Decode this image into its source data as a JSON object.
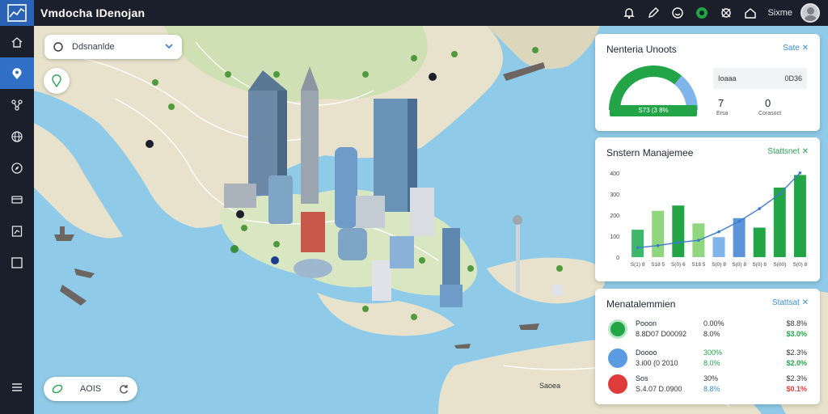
{
  "app": {
    "title": "Vmdocha IDenojan"
  },
  "topbar": {
    "icons": [
      "bell-icon",
      "pencil-icon",
      "smile-icon",
      "status-icon",
      "satellite-icon",
      "home-icon"
    ],
    "user_name": "Sixme"
  },
  "sidebar": {
    "items": [
      "home-icon",
      "map-pin-icon",
      "network-icon",
      "globe-icon",
      "compass-icon",
      "truck-icon",
      "report-icon",
      "panel-icon"
    ],
    "active_index": 1,
    "menu_icon": "menu-icon"
  },
  "map": {
    "layer_select": {
      "label": "Ddsnanlde"
    },
    "zoom": {
      "label": "AOIS"
    },
    "place_labels": [
      "Saoea"
    ]
  },
  "card_stats": {
    "title": "Nenteria Unoots",
    "link": "Sate",
    "gauge_label": "S73 (3 8%",
    "gauge_fraction": 0.72,
    "stat_label": "Ioaaa",
    "stat_value": "0D36",
    "metric_a": {
      "value": "7",
      "sub": "Ersa"
    },
    "metric_b": {
      "value": "0",
      "sub": "Corasoct"
    }
  },
  "card_chart": {
    "title": "Snstern Manajemee",
    "link": "Stattsnet"
  },
  "chart_data": {
    "type": "bar",
    "categories": [
      "S(1) 8",
      "S18 5",
      "S(0) 6",
      "S18 5",
      "S(0) 8",
      "S(0) 8",
      "S(0) 8",
      "S(00)",
      "S(0) 8"
    ],
    "values": [
      130,
      220,
      245,
      160,
      95,
      185,
      140,
      330,
      390
    ],
    "line_values": [
      45,
      55,
      70,
      80,
      120,
      170,
      230,
      300,
      400
    ],
    "bar_colors": [
      "#3db86a",
      "#8fd67e",
      "#22a447",
      "#8fd67e",
      "#7fb5e9",
      "#5d93d9",
      "#22a447",
      "#22a447",
      "#22a447"
    ],
    "line_color": "#3d7cc9",
    "y_ticks": [
      "0",
      "100",
      "200",
      "300",
      "400"
    ],
    "ylim": [
      0,
      430
    ],
    "grid": false
  },
  "card_markets": {
    "title": "Menatalemmien",
    "link": "Stattsat",
    "rows": [
      {
        "name": "Pooon",
        "sub": "8.8D07 D00092",
        "pct1": "0.00%",
        "pct2": "8.0%",
        "val1": "$8.8%",
        "val2": "$3.0%",
        "color": "#22a447",
        "val2_color": "#22a447"
      },
      {
        "name": "Doooo",
        "sub": "3.i00 (0 2010",
        "pct1": "300%",
        "pct2": "8.0%",
        "val1": "$2.3%",
        "val2": "$2.0%",
        "color": "#5b9be0",
        "val2_color": "#22a447"
      },
      {
        "name": "Sos",
        "sub": "S.4.07 D.0900",
        "pct1": "30%",
        "pct2": "8.8%",
        "val1": "$2.3%",
        "val2": "$0.1%",
        "color": "#e03b3b",
        "val2_color": "#e03b3b"
      }
    ]
  }
}
